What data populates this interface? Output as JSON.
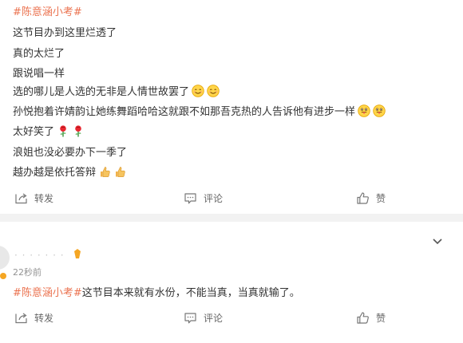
{
  "post1": {
    "topic": "#陈意涵小考#",
    "lines": [
      "这节目办到这里烂透了",
      "真的太烂了",
      "跟说唱一样",
      "选的哪儿是人选的无非是人情世故罢了",
      "孙悦抱着许婧韵让她练舞蹈哈哈这就跟不如那吾克热的人告诉他有进步一样",
      "太好笑了",
      "浪姐也没必要办下一季了",
      "越办越是依托答辩"
    ],
    "emoji_icons": [
      "smile-emoji-icon",
      "tongue-emoji-icon",
      "rose-icon",
      "thumbs-up-icon"
    ],
    "actions": {
      "repost": "转发",
      "comment": "评论",
      "like": "赞"
    }
  },
  "post2": {
    "username": "· · · ·  ·  · ·",
    "time": "22秒前",
    "topic": "#陈意涵小考#",
    "text": " 这节目本来就有水份，不能当真，当真就输了。",
    "actions": {
      "repost": "转发",
      "comment": "评论",
      "like": "赞"
    }
  },
  "colors": {
    "topic": "#eb7350",
    "text": "#333333",
    "meta": "#939393",
    "divider": "#f2f2f2"
  }
}
